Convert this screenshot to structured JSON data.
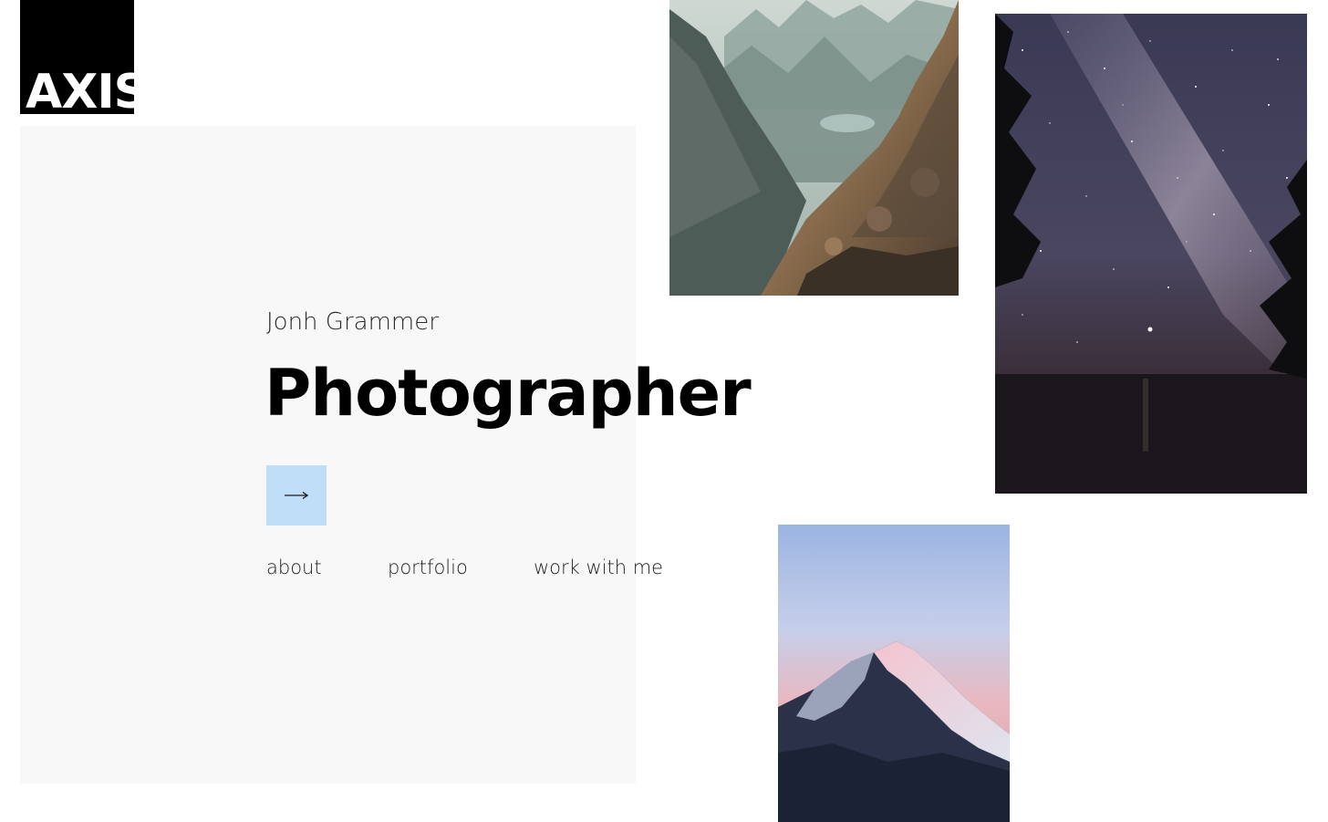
{
  "brand": {
    "logo_text": "AXIS"
  },
  "hero": {
    "name": "Jonh Grammer",
    "title": "Photographer",
    "cta_icon": "arrow-right-icon"
  },
  "nav": {
    "items": [
      {
        "label": "about"
      },
      {
        "label": "portfolio"
      },
      {
        "label": "work with me"
      }
    ]
  },
  "gallery": {
    "photos": [
      {
        "subject": "rocky mountain valley"
      },
      {
        "subject": "milky way night sky over water"
      },
      {
        "subject": "snowy mountain peak at dusk"
      }
    ]
  },
  "colors": {
    "accent": "#bfdef8",
    "panel": "#f8f8f8",
    "text": "#000000",
    "logo_bg": "#000000"
  }
}
